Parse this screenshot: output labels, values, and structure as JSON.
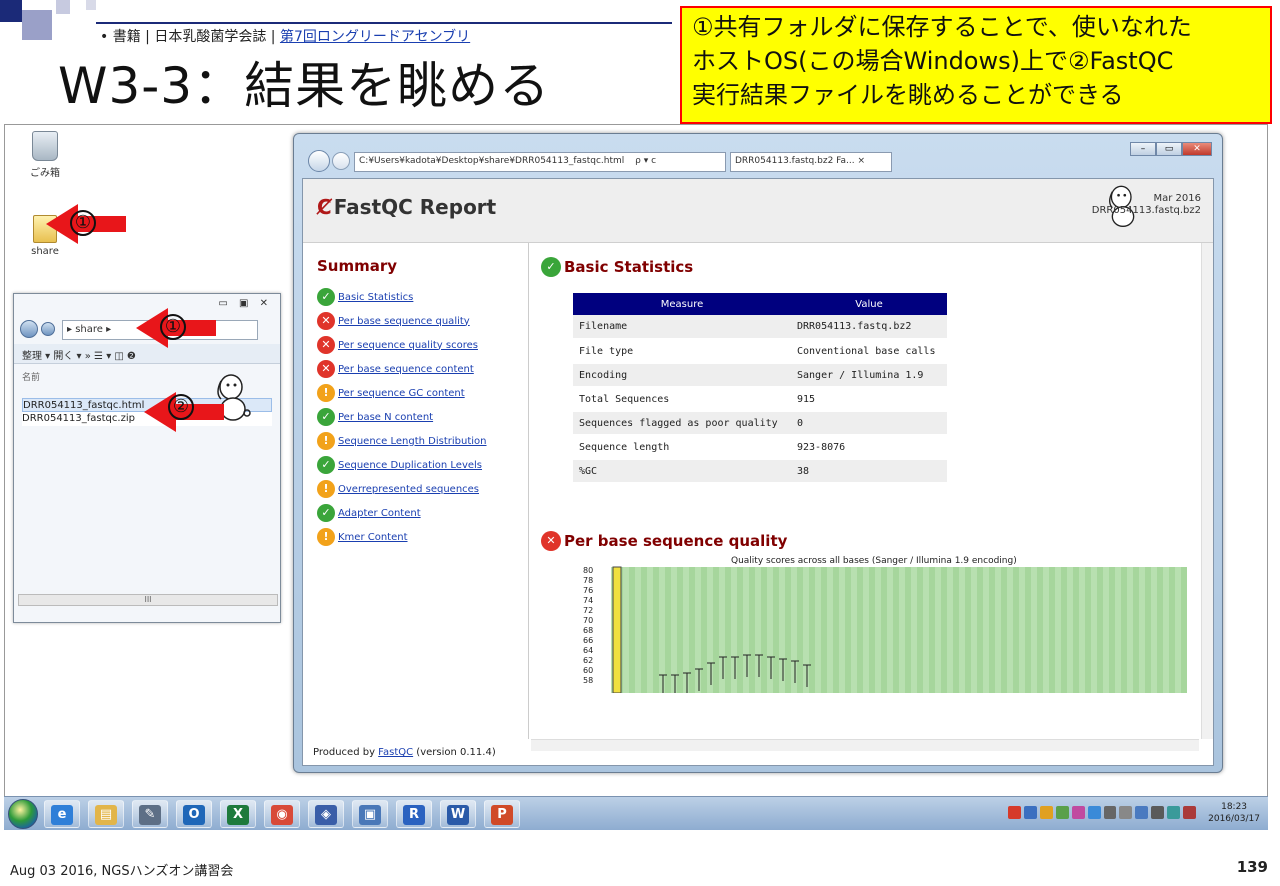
{
  "slide": {
    "breadcrumb_prefix": "• 書籍 | 日本乳酸菌学会誌 | ",
    "breadcrumb_link": "第7回ロングリードアセンブリ",
    "title": "W3-3：結果を眺める",
    "callout_lines": [
      "①共有フォルダに保存することで、使いなれた",
      "ホストOS(この場合Windows)上で②FastQC",
      "実行結果ファイルを眺めることができる"
    ],
    "footer_left": "Aug 03 2016, NGSハンズオン講習会",
    "slide_number": "139",
    "arrow_labels": [
      "①",
      "①",
      "②"
    ]
  },
  "desktop": {
    "trash_label": "ごみ箱",
    "share_label": "share",
    "share_icon": "folder-icon"
  },
  "explorer": {
    "window_controls": "▭ ▣ ✕",
    "path": "▸ share ▸",
    "toolbar": "整理 ▾   開く ▾   »   ☰ ▾   ◫   ❷",
    "column_name": "名前",
    "files": [
      "DRR054113_fastqc.html",
      "DRR054113_fastqc.zip"
    ],
    "scrollbar_glyph": "III"
  },
  "browser": {
    "url": "C:¥Users¥kadota¥Desktop¥share¥DRR054113_fastqc.html",
    "url_controls": "ρ ▾ c",
    "tab_title": "DRR054113.fastq.bz2 Fa... ×",
    "fastqc_title": "FastQC Report",
    "date": "Mar 2016",
    "filename_right": "DRR054113.fastq.bz2",
    "summary_title": "Summary",
    "modules": [
      {
        "label": "Basic Statistics",
        "status": "pass"
      },
      {
        "label": "Per base sequence quality",
        "status": "fail"
      },
      {
        "label": "Per sequence quality scores",
        "status": "fail"
      },
      {
        "label": "Per base sequence content",
        "status": "fail"
      },
      {
        "label": "Per sequence GC content",
        "status": "warn"
      },
      {
        "label": "Per base N content",
        "status": "pass"
      },
      {
        "label": "Sequence Length Distribution",
        "status": "warn"
      },
      {
        "label": "Sequence Duplication Levels",
        "status": "pass"
      },
      {
        "label": "Overrepresented sequences",
        "status": "warn"
      },
      {
        "label": "Adapter Content",
        "status": "pass"
      },
      {
        "label": "Kmer Content",
        "status": "warn"
      }
    ],
    "basic_stats_heading": "Basic Statistics",
    "table_headers": [
      "Measure",
      "Value"
    ],
    "table_rows": [
      [
        "Filename",
        "DRR054113.fastq.bz2"
      ],
      [
        "File type",
        "Conventional base calls"
      ],
      [
        "Encoding",
        "Sanger / Illumina 1.9"
      ],
      [
        "Total Sequences",
        "915"
      ],
      [
        "Sequences flagged as poor quality",
        "0"
      ],
      [
        "Sequence length",
        "923-8076"
      ],
      [
        "%GC",
        "38"
      ]
    ],
    "quality_heading": "Per base sequence quality",
    "chart_title": "Quality scores across all bases (Sanger / Illumina 1.9 encoding)",
    "y_ticks": [
      "80",
      "78",
      "76",
      "74",
      "72",
      "70",
      "68",
      "66",
      "64",
      "62",
      "60",
      "58"
    ],
    "footer_prefix": "Produced by ",
    "footer_link": "FastQC",
    "footer_suffix": " (version 0.11.4)"
  },
  "taskbar": {
    "clock_time": "18:23",
    "clock_date": "2016/03/17",
    "apps": [
      {
        "name": "ie-icon",
        "color": "#2f7fd8",
        "glyph": "e"
      },
      {
        "name": "explorer-icon",
        "color": "#e2b54a",
        "glyph": "▤"
      },
      {
        "name": "notepad-icon",
        "color": "#5d6f86",
        "glyph": "✎"
      },
      {
        "name": "outlook-icon",
        "color": "#1f67b8",
        "glyph": "O"
      },
      {
        "name": "excel-icon",
        "color": "#1e7a3c",
        "glyph": "X"
      },
      {
        "name": "chrome-icon",
        "color": "#d84a38",
        "glyph": "◉"
      },
      {
        "name": "virtualbox-icon",
        "color": "#3a5ea8",
        "glyph": "◈"
      },
      {
        "name": "cmd-icon",
        "color": "#4a78b8",
        "glyph": "▣"
      },
      {
        "name": "r-icon",
        "color": "#2a62c0",
        "glyph": "R"
      },
      {
        "name": "word-icon",
        "color": "#2a5aa8",
        "glyph": "W"
      },
      {
        "name": "powerpoint-icon",
        "color": "#d04a28",
        "glyph": "P"
      }
    ]
  }
}
